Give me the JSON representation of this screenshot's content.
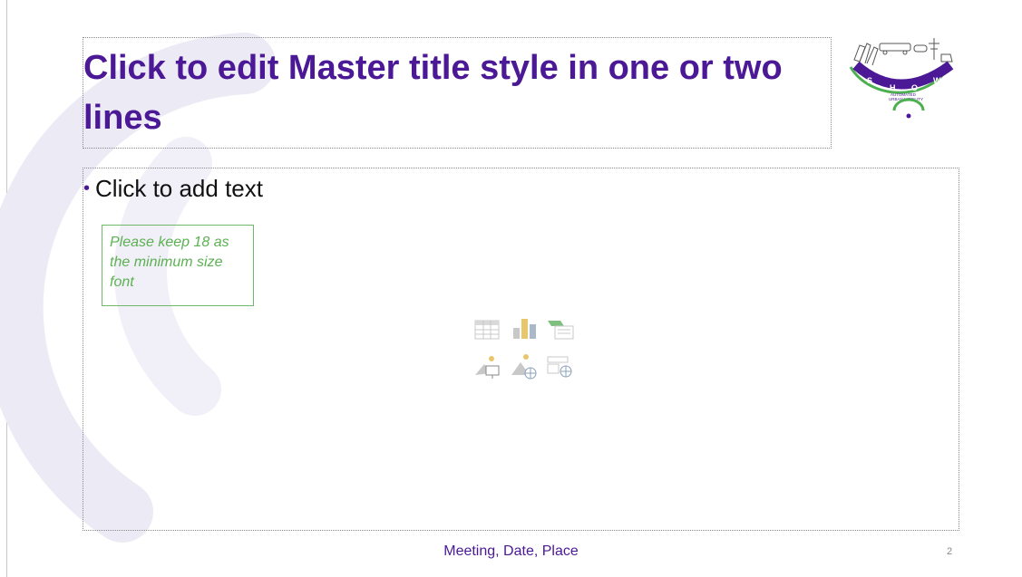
{
  "slide": {
    "title": "Click to edit Master title style in one or two lines",
    "body_bullet": "Click to add text",
    "note": "Please keep 18 as the minimum size font",
    "footer": "Meeting, Date, Place",
    "slide_number": "2"
  },
  "logo": {
    "letters": [
      "S",
      "H",
      "O",
      "W"
    ],
    "tagline_line1": "AUTOMATED",
    "tagline_line2": "URBAN MOBILITY"
  },
  "placeholder_icons": [
    "insert-table-icon",
    "insert-chart-icon",
    "insert-smartart-icon",
    "insert-picture-icon",
    "insert-online-picture-icon",
    "insert-video-icon"
  ],
  "colors": {
    "title": "#4b1896",
    "note": "#5cb153",
    "accent_green": "#4caf50",
    "arc": "#eceaf4"
  }
}
